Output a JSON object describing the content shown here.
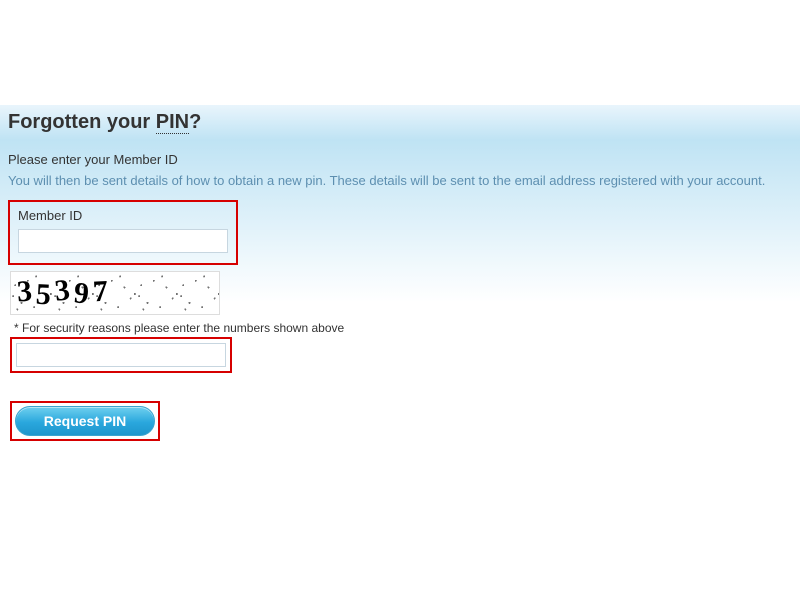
{
  "header": {
    "title_prefix": "Forgotten your ",
    "title_pin": "PIN",
    "title_suffix": "?"
  },
  "subhead": "Please enter your Member ID",
  "info": "You will then be sent details of how to obtain a new pin. These details will be sent to the email address registered with your account.",
  "member_id": {
    "label": "Member ID",
    "value": ""
  },
  "captcha": {
    "digits": [
      "3",
      "5",
      "3",
      "9",
      "7"
    ],
    "note": "* For security reasons please enter the numbers shown above",
    "value": ""
  },
  "button": {
    "label": "Request PIN"
  },
  "colors": {
    "highlight_border": "#d60000",
    "button_gradient_top": "#6fd0ef",
    "button_gradient_bottom": "#1e96cc",
    "info_text": "#5d8fb0"
  }
}
